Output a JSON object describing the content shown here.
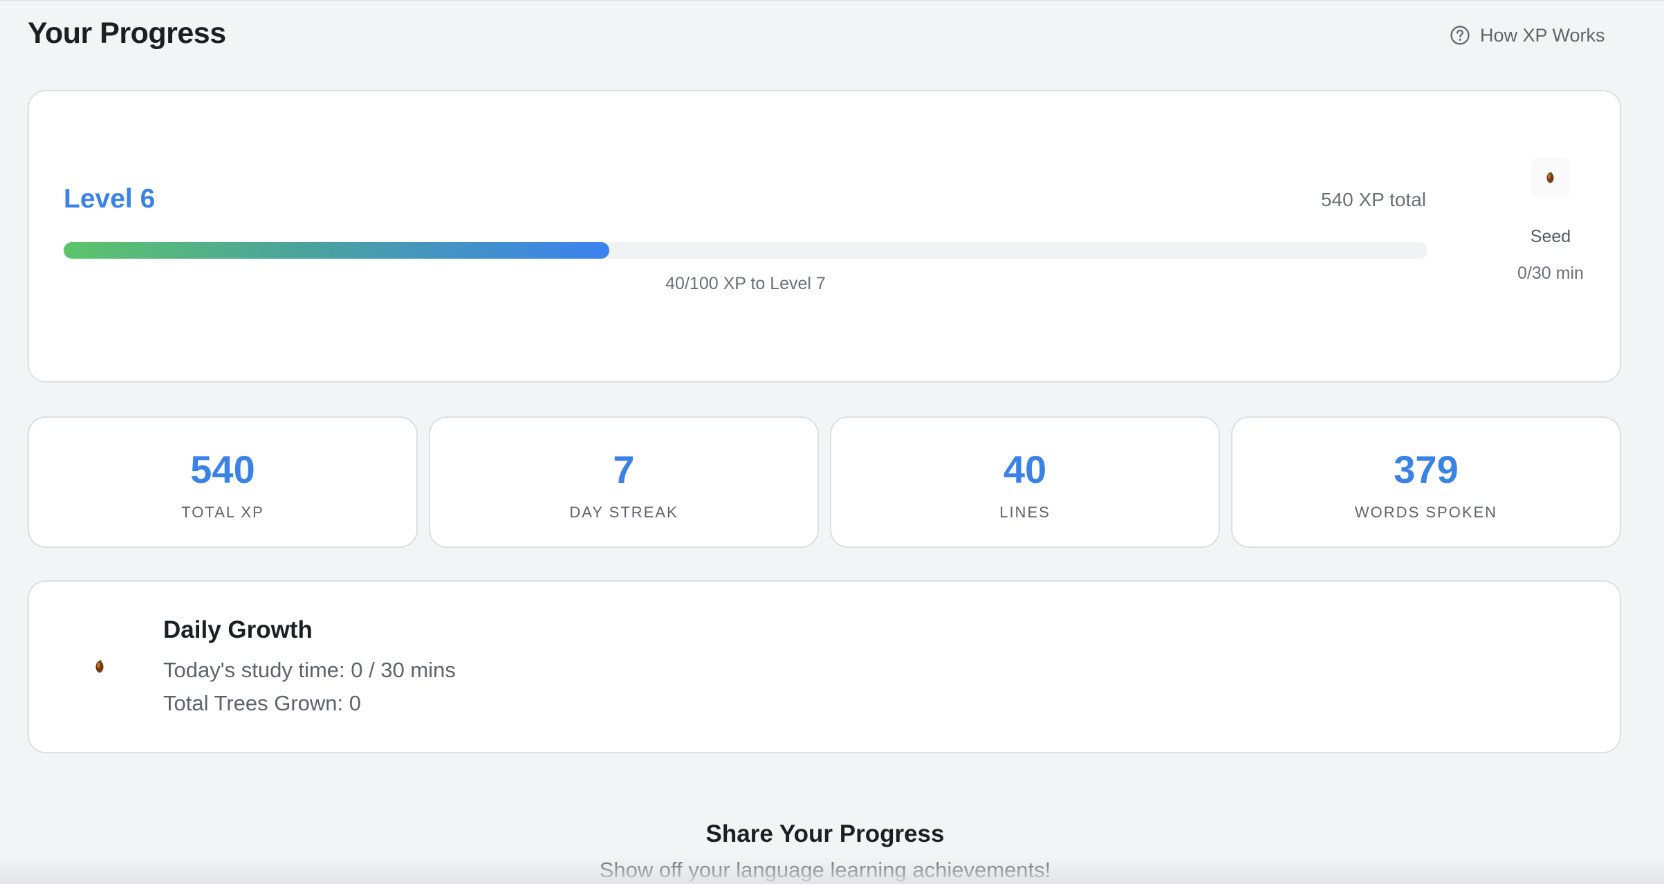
{
  "header": {
    "title": "Your Progress",
    "how_xp_label": "How XP Works",
    "help_icon": "question-circle-icon"
  },
  "level": {
    "title": "Level 6",
    "xp_total": "540 XP total",
    "progress_fraction": 0.4,
    "progress_caption": "40/100 XP to Level 7",
    "stage_icon": "seed-icon",
    "stage_name": "Seed",
    "stage_time": "0/30 min"
  },
  "stats": [
    {
      "value": "540",
      "label": "TOTAL XP"
    },
    {
      "value": "7",
      "label": "DAY STREAK"
    },
    {
      "value": "40",
      "label": "LINES"
    },
    {
      "value": "379",
      "label": "WORDS SPOKEN"
    }
  ],
  "daily": {
    "icon": "seed-icon",
    "title": "Daily Growth",
    "study_time": "Today's study time: 0 / 30 mins",
    "trees": "Total Trees Grown: 0"
  },
  "share": {
    "title": "Share Your Progress",
    "subtitle": "Show off your language learning achievements!"
  },
  "colors": {
    "accent": "#3b82e6",
    "progress_start": "#5cc46a",
    "progress_end": "#3b82f0",
    "background": "#f3f4f6",
    "card": "#ffffff"
  }
}
